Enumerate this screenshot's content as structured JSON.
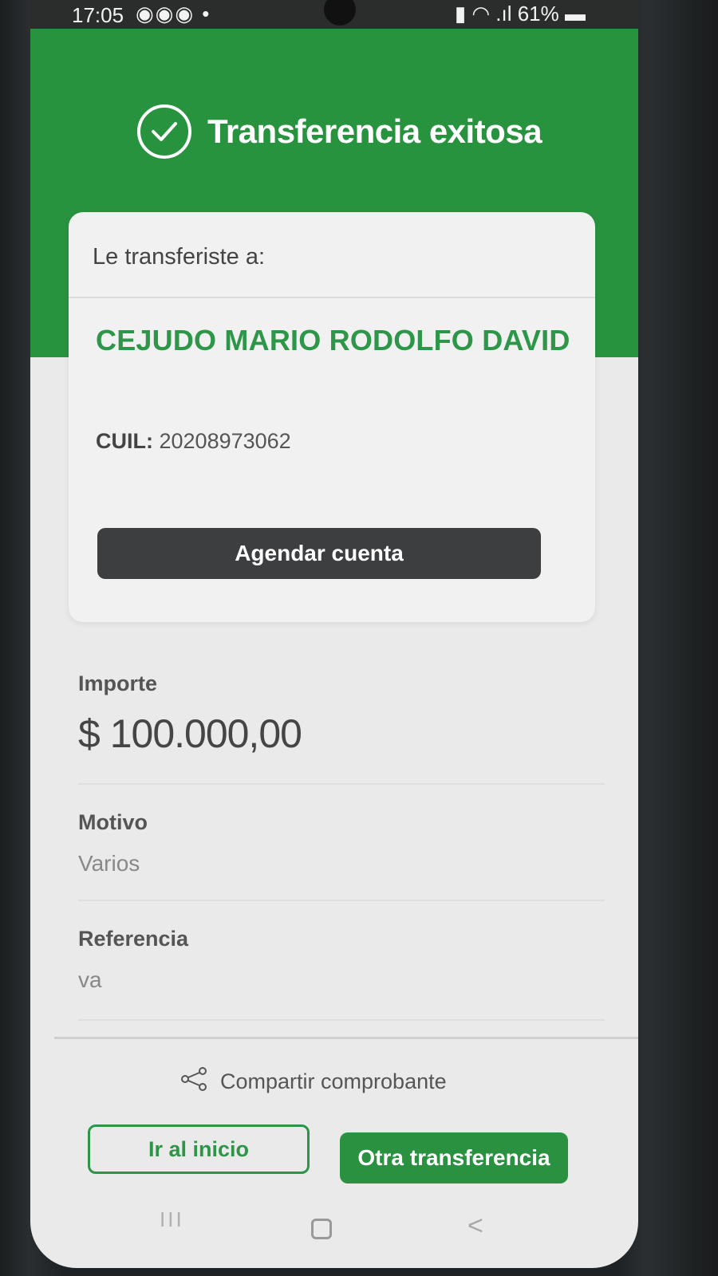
{
  "status_bar": {
    "time": "17:05",
    "notifications": "◉◉◉ •",
    "right": "61%"
  },
  "header": {
    "title": "Transferencia exitosa",
    "icon": "check-circle-icon",
    "color": "#28933e"
  },
  "recipient_card": {
    "label": "Le transferiste a:",
    "name": "CEJUDO MARIO RODOLFO DAVID",
    "cuil_label": "CUIL:",
    "cuil_value": "20208973062",
    "agendar_label": "Agendar cuenta"
  },
  "details": {
    "importe_label": "Importe",
    "importe_value": "$ 100.000,00",
    "motivo_label": "Motivo",
    "motivo_value": "Varios",
    "referencia_label": "Referencia",
    "referencia_value": "va"
  },
  "actions": {
    "share_label": "Compartir comprobante",
    "share_icon": "share-icon",
    "home_label": "Ir al inicio",
    "another_label": "Otra transferencia",
    "accent": "#2a9140"
  },
  "nav": {
    "recent": "III",
    "back": "<"
  }
}
